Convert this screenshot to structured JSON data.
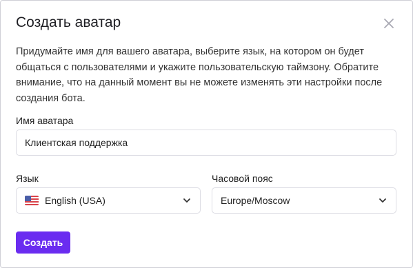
{
  "dialog": {
    "title": "Создать аватар",
    "description": "Придумайте имя для вашего аватара, выберите язык, на котором он будет общаться с пользователями и укажите пользовательскую таймзону. Обратите внимание, что на данный момент вы не можете изменять эти настройки после создания бота."
  },
  "form": {
    "name_label": "Имя аватара",
    "name_value": "Клиентская поддержка",
    "language_label": "Язык",
    "language_value": "English (USA)",
    "language_flag": "us-flag-icon",
    "timezone_label": "Часовой пояс",
    "timezone_value": "Europe/Moscow"
  },
  "actions": {
    "create_label": "Создать"
  },
  "colors": {
    "accent": "#6a2cf0",
    "border": "#dcdce3",
    "close_icon": "#a9a9b3"
  }
}
